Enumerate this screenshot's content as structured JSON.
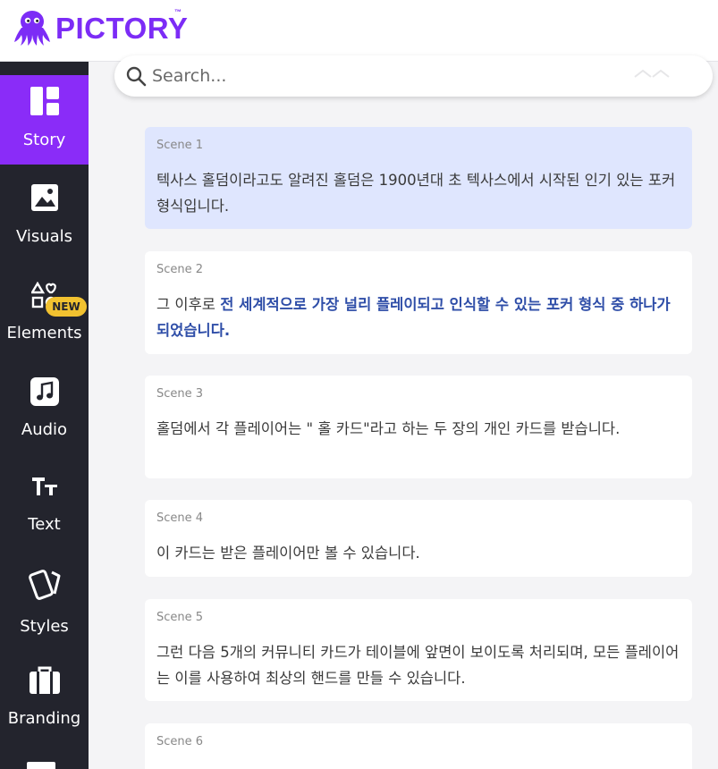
{
  "app": {
    "logo_text": "PICTORY",
    "logo_tm": "™",
    "brand_color": "#7c2cf6"
  },
  "sidebar": {
    "items": [
      {
        "label": "Story",
        "icon": "story-icon",
        "active": true
      },
      {
        "label": "Visuals",
        "icon": "image-icon"
      },
      {
        "label": "Elements",
        "icon": "shapes-icon"
      },
      {
        "label": "Audio",
        "icon": "music-note-icon",
        "badge": "NEW"
      },
      {
        "label": "Text",
        "icon": "text-size-icon"
      },
      {
        "label": "Styles",
        "icon": "styles-cards-icon"
      },
      {
        "label": "Branding",
        "icon": "briefcase-icon"
      }
    ],
    "active_color": "#8a2cf8",
    "background_color": "#23242d"
  },
  "search": {
    "placeholder": "Search..."
  },
  "scenes": [
    {
      "label": "Scene 1",
      "text": "텍사스 홀덤이라고도 알려진 홀덤은 1900년대 초 텍사스에서 시작된 인기 있는 포커 형식입니다.",
      "selected": true
    },
    {
      "label": "Scene 2",
      "text_plain": "그 이후로 ",
      "text_highlight": "전 세계적으로 가장 널리 플레이되고 인식할 수 있는 포커 형식 중 하나가 되었습니다.",
      "highlight_color": "#2f4ea8"
    },
    {
      "label": "Scene 3",
      "text": "홀덤에서 각 플레이어는 \" 홀 카드\"라고 하는 두 장의 개인 카드를 받습니다."
    },
    {
      "label": "Scene 4",
      "text": "이 카드는 받은 플레이어만 볼 수 있습니다."
    },
    {
      "label": "Scene 5",
      "text": "그런 다음 5개의 커뮤니티 카드가 테이블에 앞면이 보이도록 처리되며, 모든 플레이어는 이를 사용하여 최상의 핸드를 만들 수 있습니다."
    },
    {
      "label": "Scene 6",
      "text": ""
    }
  ]
}
